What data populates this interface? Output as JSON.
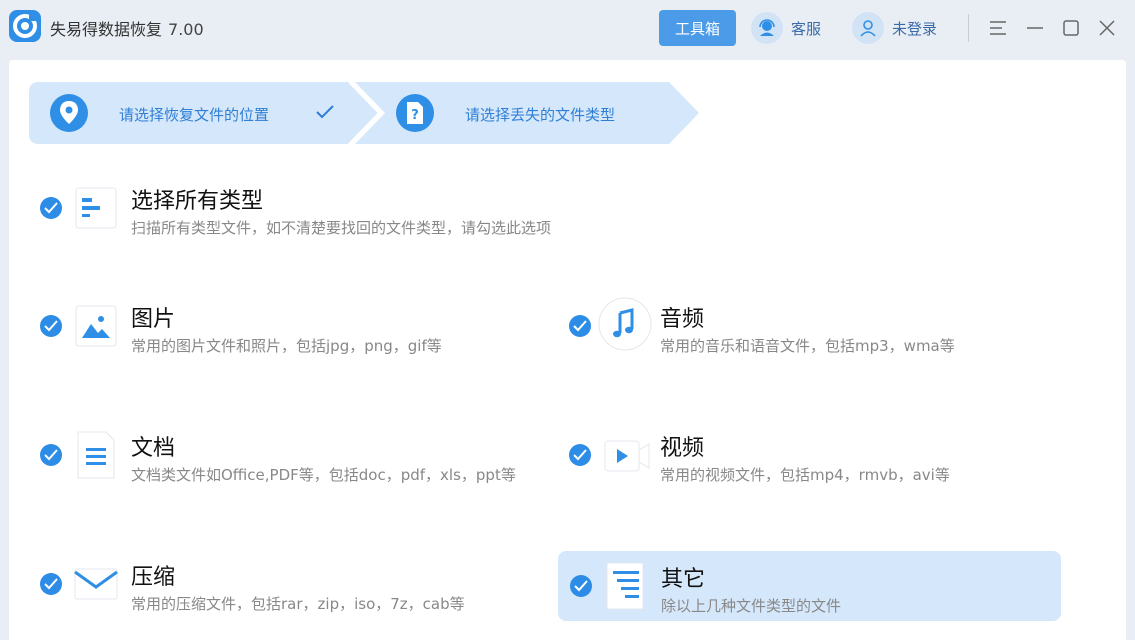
{
  "app": {
    "title": "失易得数据恢复",
    "version": "7.00"
  },
  "header": {
    "toolbox_label": "工具箱",
    "service_label": "客服",
    "login_label": "未登录"
  },
  "steps": [
    {
      "label": "请选择恢复文件的位置",
      "completed": true
    },
    {
      "label": "请选择丢失的文件类型",
      "completed": false
    }
  ],
  "options": {
    "all": {
      "title": "选择所有类型",
      "desc": "扫描所有类型文件，如不清楚要找回的文件类型，请勾选此选项",
      "checked": true
    },
    "image": {
      "title": "图片",
      "desc": "常用的图片文件和照片，包括jpg，png，gif等",
      "checked": true
    },
    "audio": {
      "title": "音频",
      "desc": "常用的音乐和语音文件，包括mp3，wma等",
      "checked": true
    },
    "document": {
      "title": "文档",
      "desc": "文档类文件如Office,PDF等，包括doc，pdf，xls，ppt等",
      "checked": true
    },
    "video": {
      "title": "视频",
      "desc": "常用的视频文件，包括mp4，rmvb，avi等",
      "checked": true
    },
    "archive": {
      "title": "压缩",
      "desc": "常用的压缩文件，包括rar，zip，iso，7z，cab等",
      "checked": true
    },
    "other": {
      "title": "其它",
      "desc": "除以上几种文件类型的文件",
      "checked": true,
      "highlighted": true
    }
  },
  "colors": {
    "accent": "#2d8ce5",
    "step_bg": "#d5e7fa",
    "selected_bg": "#d5e7fa"
  }
}
